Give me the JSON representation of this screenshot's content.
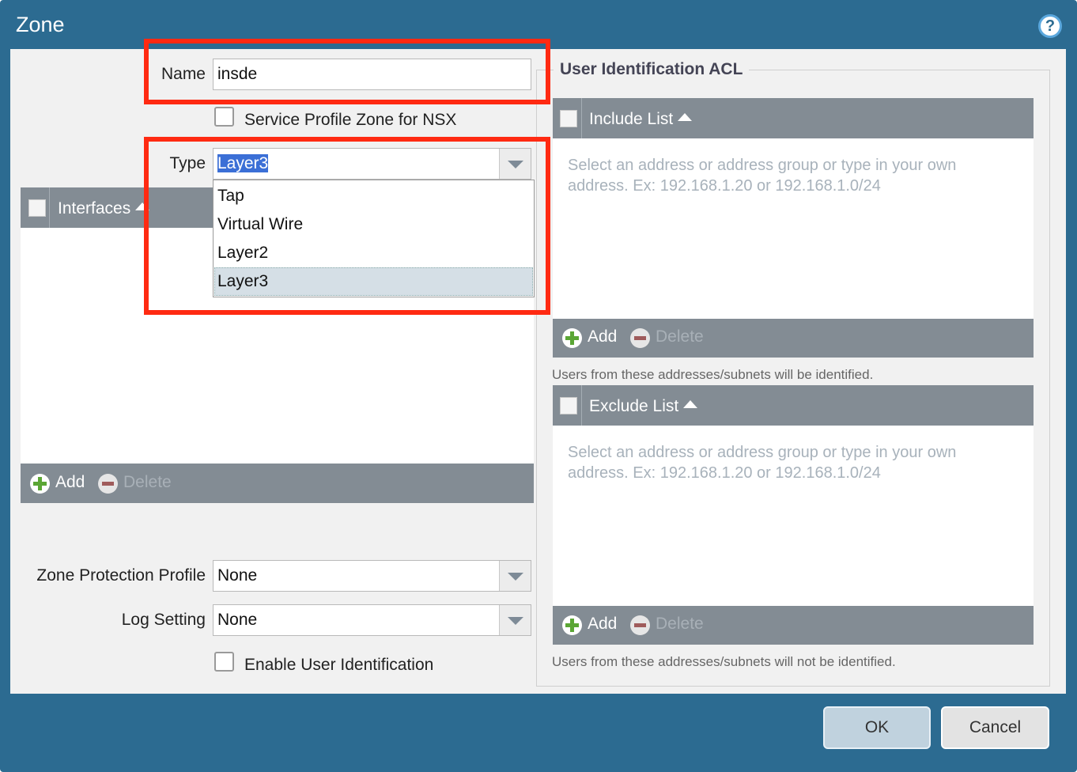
{
  "dialog": {
    "title": "Zone",
    "help_icon": "help-icon"
  },
  "name_field": {
    "label": "Name",
    "value": "insde"
  },
  "nsx_checkbox": {
    "label": "Service Profile Zone for NSX",
    "checked": false
  },
  "type_field": {
    "label": "Type",
    "value": "Layer3",
    "options": [
      "Tap",
      "Virtual Wire",
      "Layer2",
      "Layer3"
    ],
    "highlighted_option": "Layer3"
  },
  "interfaces": {
    "header": "Interfaces",
    "add_label": "Add",
    "delete_label": "Delete"
  },
  "zone_protection": {
    "label": "Zone Protection Profile",
    "value": "None"
  },
  "log_setting": {
    "label": "Log Setting",
    "value": "None"
  },
  "enable_user_id": {
    "label": "Enable User Identification",
    "checked": false
  },
  "user_id_acl": {
    "title": "User Identification ACL",
    "include_list": {
      "header": "Include List",
      "hint": "Select an address or address group or type in your own address. Ex: 192.168.1.20 or 192.168.1.0/24",
      "add_label": "Add",
      "delete_label": "Delete",
      "note": "Users from these addresses/subnets will be identified."
    },
    "exclude_list": {
      "header": "Exclude List",
      "hint": "Select an address or address group or type in your own address. Ex: 192.168.1.20 or 192.168.1.0/24",
      "add_label": "Add",
      "delete_label": "Delete",
      "note": "Users from these addresses/subnets will not be identified."
    }
  },
  "buttons": {
    "ok": "OK",
    "cancel": "Cancel"
  },
  "colors": {
    "title_bar": "#2c6b91",
    "panel": "#f1f1f1",
    "grid_header": "#838c94",
    "annotation_highlight": "#ff2a12",
    "add_icon": "#5ba635"
  }
}
